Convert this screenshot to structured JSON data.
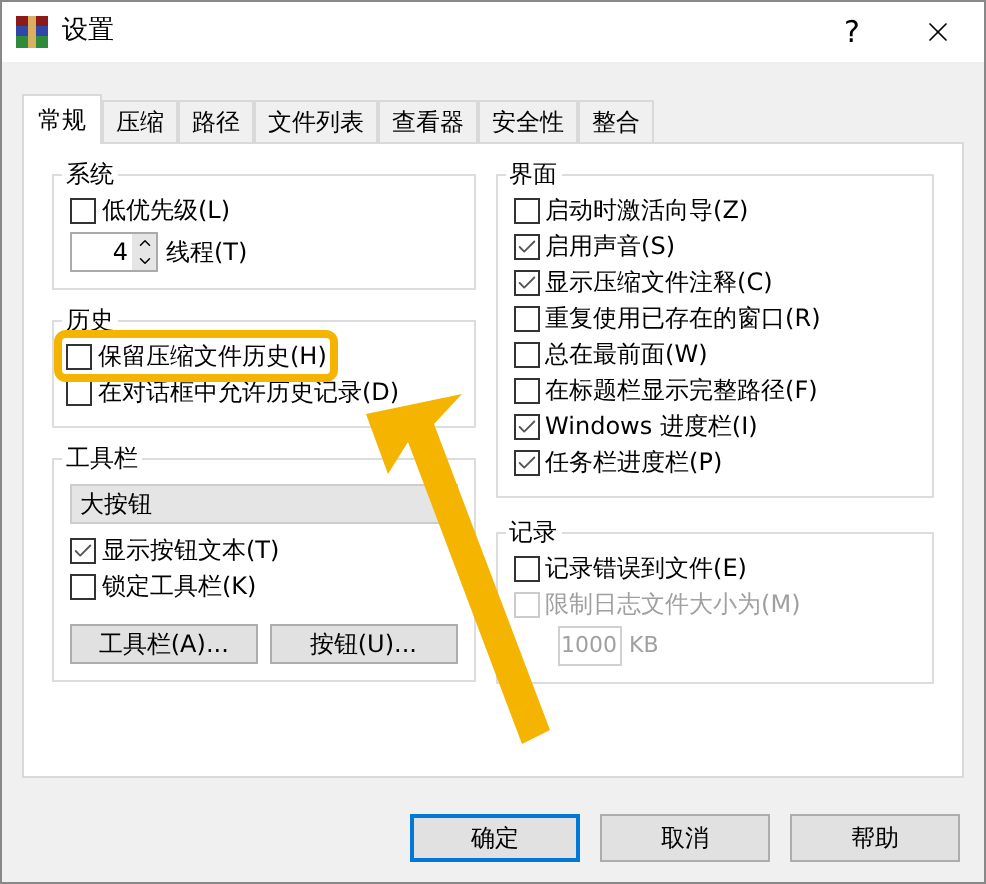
{
  "window": {
    "title": "设置",
    "help": "?"
  },
  "tabs": [
    {
      "label": "常规",
      "selected": true
    },
    {
      "label": "压缩",
      "selected": false
    },
    {
      "label": "路径",
      "selected": false
    },
    {
      "label": "文件列表",
      "selected": false
    },
    {
      "label": "查看器",
      "selected": false
    },
    {
      "label": "安全性",
      "selected": false
    },
    {
      "label": "整合",
      "selected": false
    }
  ],
  "system": {
    "title": "系统",
    "low_priority": {
      "label": "低优先级(L)",
      "checked": false
    },
    "threads": {
      "value": "4",
      "label": "线程(T)"
    }
  },
  "history": {
    "title": "历史",
    "items": [
      {
        "label": "保留压缩文件历史(H)",
        "checked": false,
        "highlighted": true
      },
      {
        "label": "在对话框中允许历史记录(D)",
        "checked": false,
        "highlighted": false
      }
    ]
  },
  "toolbar": {
    "title": "工具栏",
    "dropdown": "大按钮",
    "items": [
      {
        "label": "显示按钮文本(T)",
        "checked": true
      },
      {
        "label": "锁定工具栏(K)",
        "checked": false
      }
    ],
    "buttons": [
      "工具栏(A)...",
      "按钮(U)..."
    ]
  },
  "interface": {
    "title": "界面",
    "items": [
      {
        "label": "启动时激活向导(Z)",
        "checked": false
      },
      {
        "label": "启用声音(S)",
        "checked": true
      },
      {
        "label": "显示压缩文件注释(C)",
        "checked": true
      },
      {
        "label": "重复使用已存在的窗口(R)",
        "checked": false
      },
      {
        "label": "总在最前面(W)",
        "checked": false
      },
      {
        "label": "在标题栏显示完整路径(F)",
        "checked": false
      },
      {
        "label": "Windows 进度栏(I)",
        "checked": true
      },
      {
        "label": "任务栏进度栏(P)",
        "checked": true
      }
    ]
  },
  "log": {
    "title": "记录",
    "items": [
      {
        "label": "记录错误到文件(E)",
        "checked": false,
        "disabled": false
      },
      {
        "label": "限制日志文件大小为(M)",
        "checked": false,
        "disabled": true
      }
    ],
    "size": {
      "value": "1000",
      "unit": "KB",
      "disabled": true
    }
  },
  "buttons": [
    {
      "label": "确定",
      "default": true
    },
    {
      "label": "取消",
      "default": false
    },
    {
      "label": "帮助",
      "default": false
    }
  ]
}
